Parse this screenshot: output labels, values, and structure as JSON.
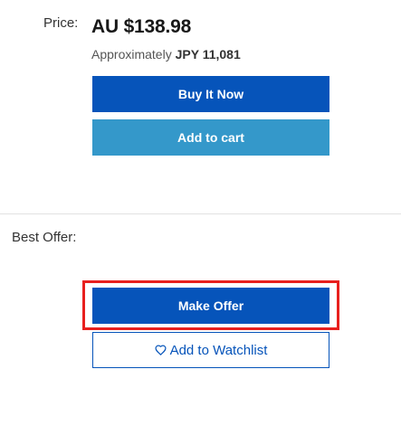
{
  "price": {
    "label": "Price:",
    "amount": "AU $138.98",
    "approx_prefix": "Approximately",
    "approx_value": "JPY 11,081"
  },
  "buttons": {
    "buy_it_now": "Buy It Now",
    "add_to_cart": "Add to cart",
    "make_offer": "Make Offer",
    "add_to_watchlist": "Add to Watchlist"
  },
  "best_offer": {
    "label": "Best Offer:"
  },
  "icons": {
    "watchlist": "heart-icon"
  },
  "colors": {
    "primary_blue": "#0654ba",
    "cart_blue": "#3498ca",
    "highlight_red": "#e8201e"
  }
}
